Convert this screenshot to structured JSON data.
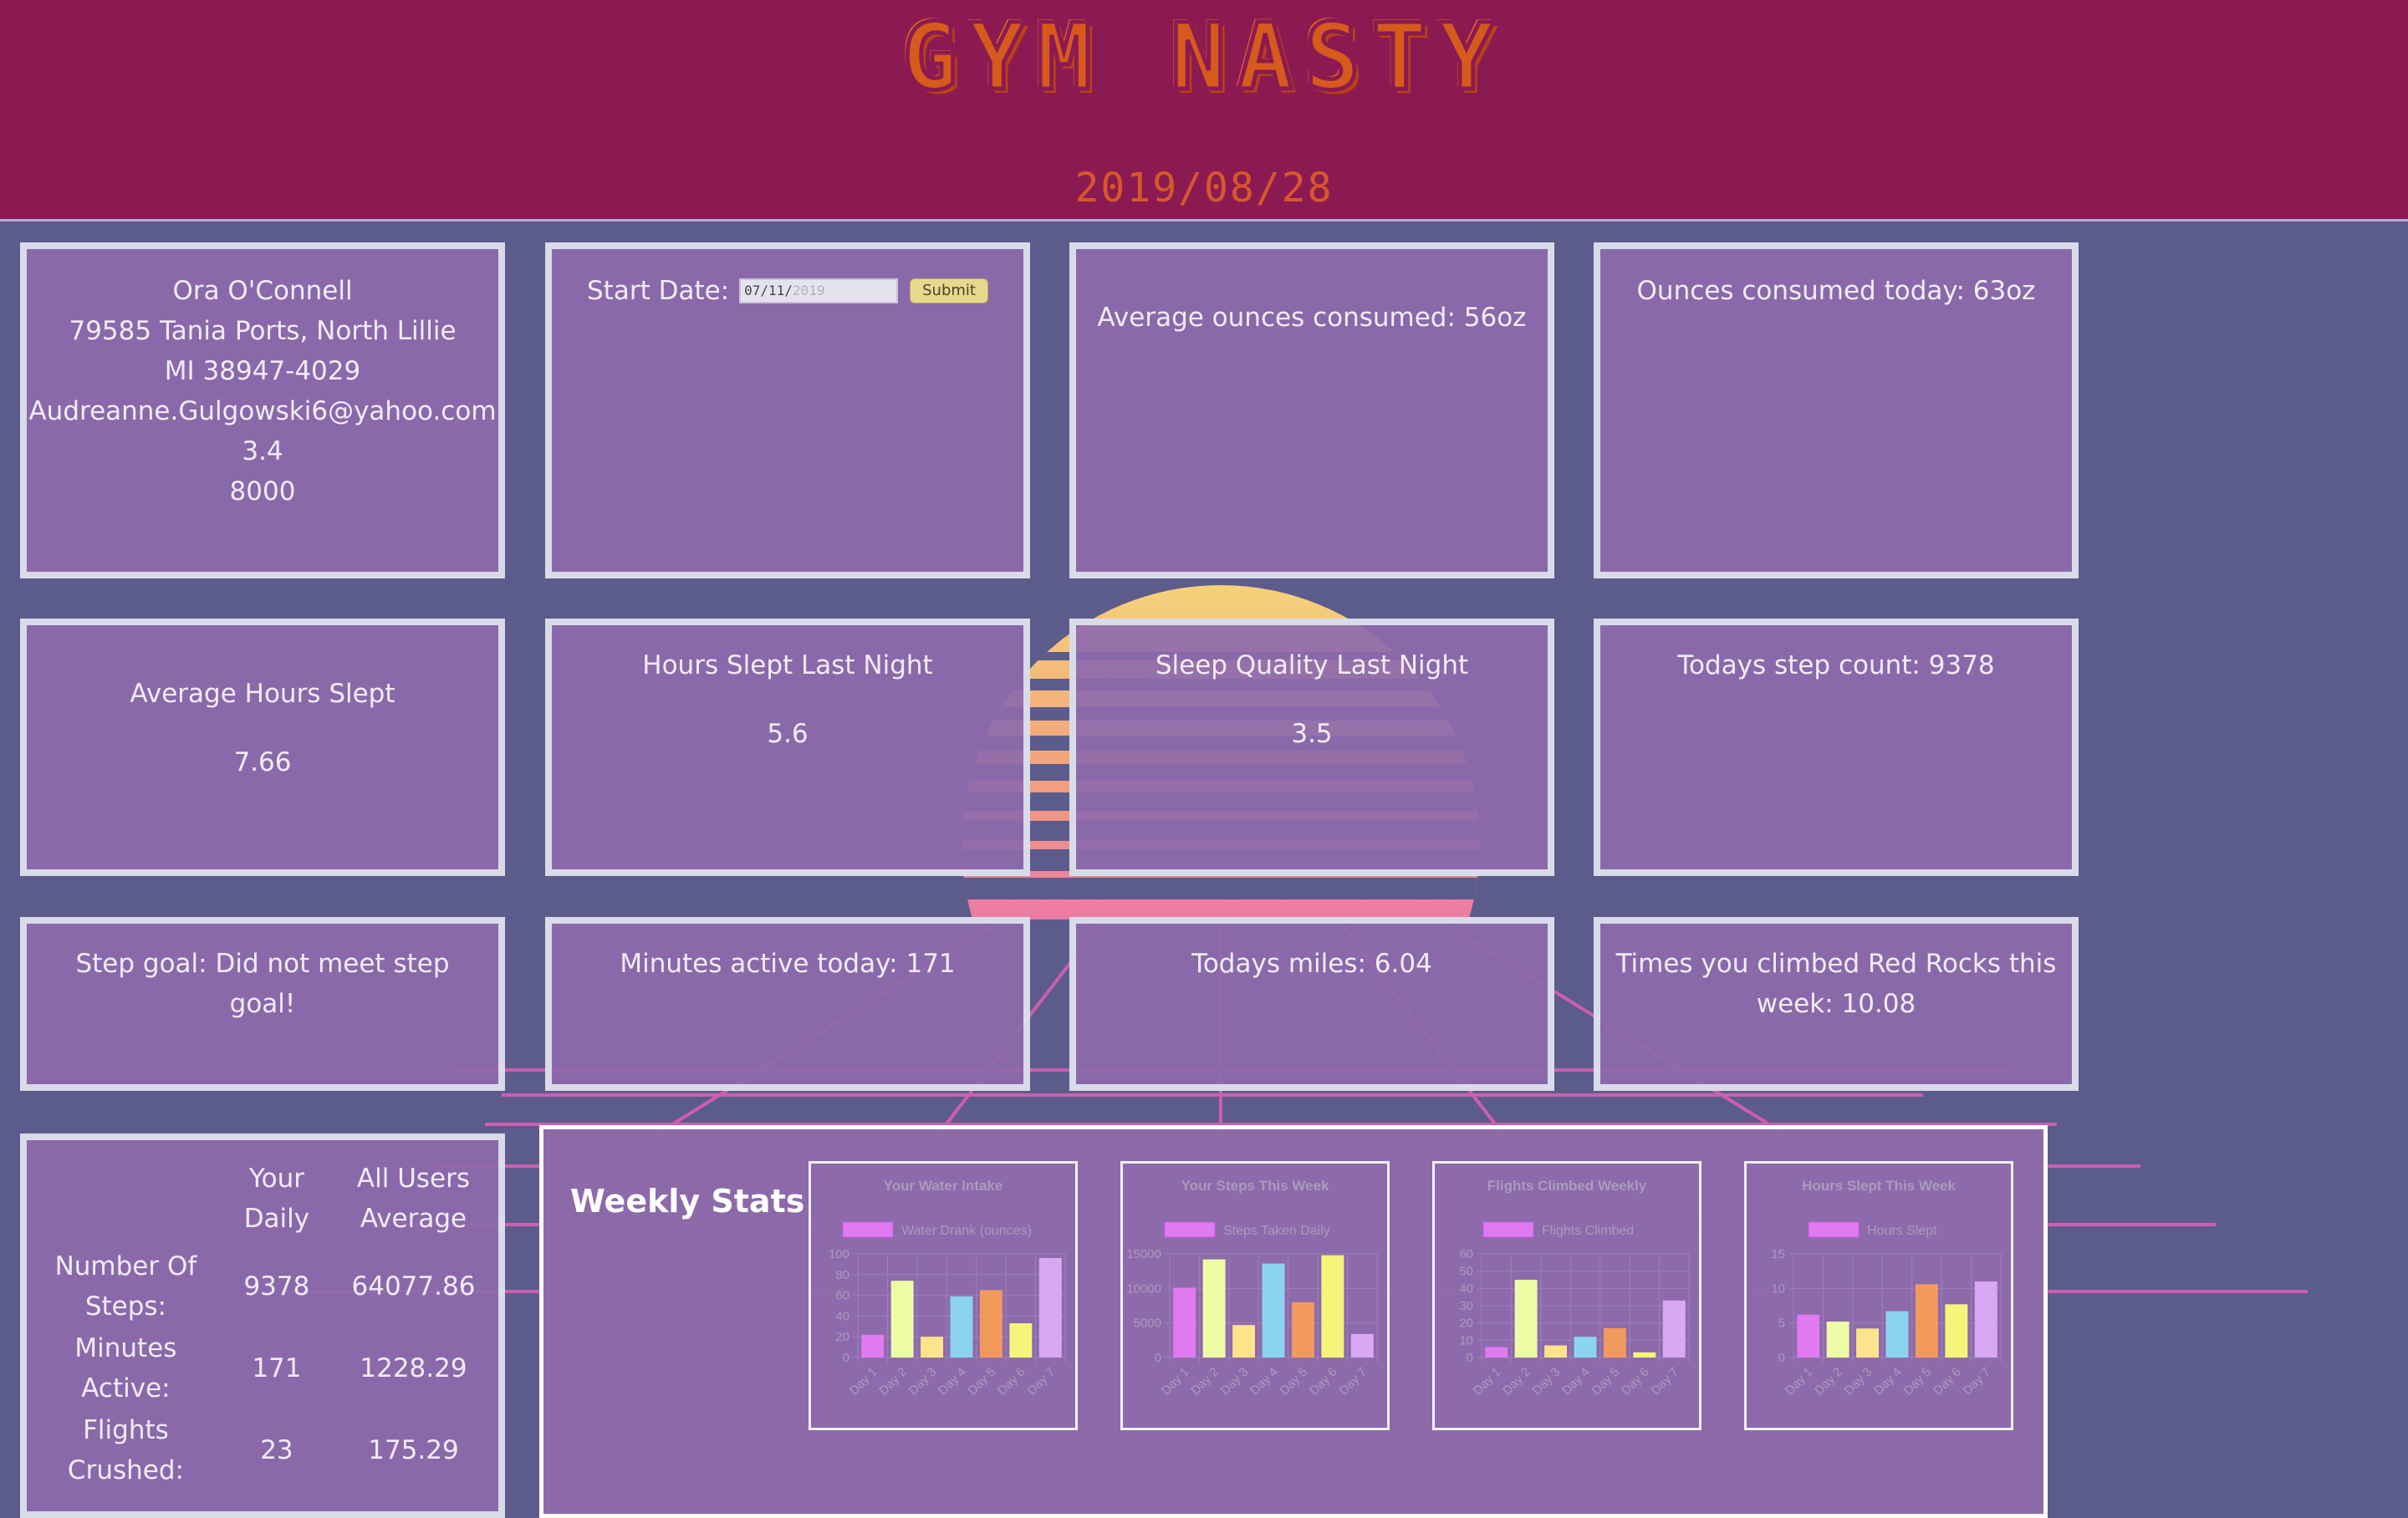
{
  "header": {
    "logo_text": "GYM NASTY",
    "date": "2019/08/28",
    "colors": {
      "header_bg": "#8c1a52",
      "logo": "#d65a1c",
      "page_bg": "#5c5c8c",
      "card_bg": "#8e6aac"
    }
  },
  "user": {
    "name": "Ora O'Connell",
    "address_line1": "79585 Tania Ports, North Lillie",
    "address_line2": "MI 38947-4029",
    "email": "Audreanne.Gulgowski6@yahoo.com",
    "stride_length": "3.4",
    "daily_step_goal": "8000"
  },
  "start_date": {
    "label": "Start Date:",
    "value_typed": "07/11/",
    "value_placeholder": "2019",
    "submit_label": "Submit"
  },
  "hydration": {
    "avg_ounces": "Average ounces consumed: 56oz",
    "today_ounces": "Ounces consumed today: 63oz"
  },
  "sleep": {
    "avg_hours_label": "Average Hours Slept",
    "avg_hours_value": "7.66",
    "last_night_hours_label": "Hours Slept Last Night",
    "last_night_hours_value": "5.6",
    "last_night_quality_label": "Sleep Quality Last Night",
    "last_night_quality_value": "3.5"
  },
  "activity": {
    "todays_steps": "Todays step count: 9378",
    "step_goal": "Step goal: Did not meet step goal!",
    "minutes_active": "Minutes active today: 171",
    "miles": "Todays miles: 6.04",
    "red_rocks": "Times you climbed Red Rocks this week: 10.08"
  },
  "comparison": {
    "headers": [
      "",
      "Your Daily",
      "All Users Average"
    ],
    "rows": [
      {
        "label": "Number Of Steps:",
        "yours": "9378",
        "average": "64077.86"
      },
      {
        "label": "Minutes Active:",
        "yours": "171",
        "average": "1228.29"
      },
      {
        "label": "Flights Crushed:",
        "yours": "23",
        "average": "175.29"
      }
    ]
  },
  "weekly": {
    "title": "Weekly Stats"
  },
  "chart_data": [
    {
      "type": "bar",
      "title": "Your Water Intake",
      "categories": [
        "Day 1",
        "Day 2",
        "Day 3",
        "Day 4",
        "Day 5",
        "Day 6",
        "Day 7"
      ],
      "series": [
        {
          "name": "Water Drank (ounces)",
          "values": [
            22,
            74,
            20,
            59,
            65,
            33,
            96
          ]
        }
      ],
      "ylim": [
        0,
        100
      ],
      "yticks": [
        0,
        20,
        40,
        60,
        80,
        100
      ],
      "bar_colors": [
        "#e07af0",
        "#eefca6",
        "#fde38a",
        "#8ad4f2",
        "#f29a5e",
        "#f5f57a",
        "#d9a8f5"
      ]
    },
    {
      "type": "bar",
      "title": "Your Steps This Week",
      "categories": [
        "Day 1",
        "Day 2",
        "Day 3",
        "Day 4",
        "Day 5",
        "Day 6",
        "Day 7"
      ],
      "series": [
        {
          "name": "Steps Taken Daily",
          "values": [
            10100,
            14200,
            4700,
            13600,
            8000,
            14800,
            3400
          ]
        }
      ],
      "ylim": [
        0,
        15000
      ],
      "yticks": [
        0,
        5000,
        10000,
        15000
      ],
      "bar_colors": [
        "#e07af0",
        "#eefca6",
        "#fde38a",
        "#8ad4f2",
        "#f29a5e",
        "#f5f57a",
        "#d9a8f5"
      ]
    },
    {
      "type": "bar",
      "title": "Flights Climbed Weekly",
      "categories": [
        "Day 1",
        "Day 2",
        "Day 3",
        "Day 4",
        "Day 5",
        "Day 6",
        "Day 7"
      ],
      "series": [
        {
          "name": "Flights Climbed",
          "values": [
            6,
            45,
            7,
            12,
            17,
            3,
            33
          ]
        }
      ],
      "ylim": [
        0,
        60
      ],
      "yticks": [
        0,
        10,
        20,
        30,
        40,
        50,
        60
      ],
      "bar_colors": [
        "#e07af0",
        "#eefca6",
        "#fde38a",
        "#8ad4f2",
        "#f29a5e",
        "#f5f57a",
        "#d9a8f5"
      ]
    },
    {
      "type": "bar",
      "title": "Hours Slept This Week",
      "categories": [
        "Day 1",
        "Day 2",
        "Day 3",
        "Day 4",
        "Day 5",
        "Day 6",
        "Day 7"
      ],
      "series": [
        {
          "name": "Hours Slept",
          "values": [
            6.2,
            5.2,
            4.2,
            6.7,
            10.6,
            7.7,
            11
          ]
        }
      ],
      "ylim": [
        0,
        15
      ],
      "yticks": [
        0,
        5,
        10,
        15
      ],
      "bar_colors": [
        "#e07af0",
        "#eefca6",
        "#fde38a",
        "#8ad4f2",
        "#f29a5e",
        "#f5f57a",
        "#d9a8f5"
      ]
    }
  ]
}
